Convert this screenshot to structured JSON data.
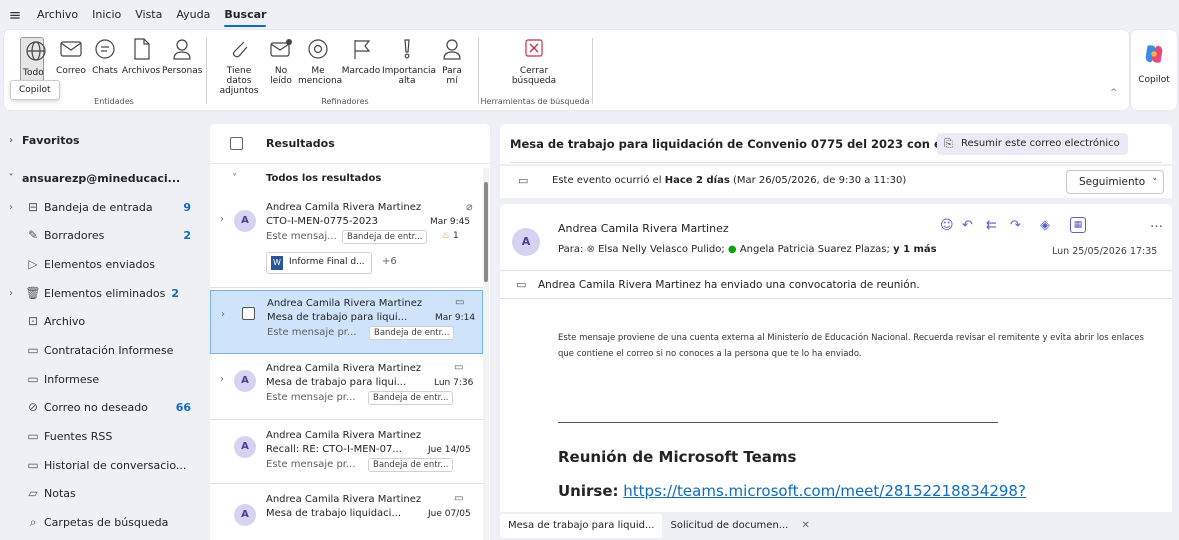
{
  "menubar": {
    "items": [
      "Archivo",
      "Inicio",
      "Vista",
      "Ayuda",
      "Buscar"
    ]
  },
  "ribbon": {
    "entidades": {
      "caption": "Entidades",
      "buttons": [
        "Todo",
        "Correo",
        "Chats",
        "Archivos",
        "Personas"
      ]
    },
    "refinadores": {
      "caption": "Refinadores",
      "buttons": [
        {
          "l1": "Tiene datos",
          "l2": "adjuntos"
        },
        {
          "l1": "No",
          "l2": "leído"
        },
        {
          "l1": "Me",
          "l2": "menciona"
        },
        {
          "l1": "Marcado",
          "l2": ""
        },
        {
          "l1": "Importancia",
          "l2": "alta"
        },
        {
          "l1": "Para",
          "l2": "mí"
        }
      ]
    },
    "herramientas": {
      "caption": "Herramientas de búsqueda",
      "close_l1": "Cerrar",
      "close_l2": "búsqueda"
    },
    "copilot_label": "Copilot",
    "tooltip": "Copilot"
  },
  "folders": {
    "favoritos": "Favoritos",
    "account": "ansuarezp@mineducaci...",
    "items": [
      {
        "label": "Bandeja de entrada",
        "count": "9"
      },
      {
        "label": "Borradores",
        "count": "2"
      },
      {
        "label": "Elementos enviados",
        "count": ""
      },
      {
        "label": "Elementos eliminados",
        "count": "2"
      },
      {
        "label": "Archivo",
        "count": ""
      },
      {
        "label": "Contratación Informese",
        "count": ""
      },
      {
        "label": "Informese",
        "count": ""
      },
      {
        "label": "Correo no deseado",
        "count": "66"
      },
      {
        "label": "Fuentes RSS",
        "count": ""
      },
      {
        "label": "Historial de conversacio...",
        "count": ""
      },
      {
        "label": "Notas",
        "count": ""
      },
      {
        "label": "Carpetas de búsqueda",
        "count": ""
      }
    ]
  },
  "results": {
    "title": "Resultados",
    "group": "Todos los resultados",
    "messages": [
      {
        "avatar": "A",
        "sender": "Andrea Camila Rivera Martinez",
        "subject": "CTO-I-MEN-0775-2023",
        "time": "Mar 9:45",
        "preview": "Este mensaj...",
        "tag": "Bandeja de entr...",
        "extra": "1",
        "attachment": "Informe Final d...",
        "more": "+6"
      },
      {
        "avatar": "",
        "sender": "Andrea Camila Rivera Martinez",
        "subject": "Mesa de trabajo para liqui...",
        "time": "Mar 9:14",
        "preview": "Este mensaje pr...",
        "tag": "Bandeja de entr..."
      },
      {
        "avatar": "A",
        "sender": "Andrea Camila Rivera Martinez",
        "subject": "Mesa de trabajo para liqui...",
        "time": "Lun 7:36",
        "preview": "Este mensaje pr...",
        "tag": "Bandeja de entr..."
      },
      {
        "avatar": "A",
        "sender": "Andrea Camila Rivera Martinez",
        "subject": "Recall: RE: CTO-I-MEN-07...",
        "time": "Jue 14/05",
        "preview": "Este mensaje pr...",
        "tag": "Bandeja de entr..."
      },
      {
        "avatar": "A",
        "sender": "Andrea Camila Rivera Martinez",
        "subject": "Mesa de trabajo liquidaci...",
        "time": "Jue 07/05",
        "preview": "",
        "tag": ""
      }
    ]
  },
  "reading": {
    "subject": "Mesa de trabajo para liquidación de Convenio 0775 del 2023 con el MEN",
    "summarize": "Resumir este correo electrónico",
    "event_prefix": "Este evento ocurrió el ",
    "event_bold": "Hace 2 días",
    "event_suffix": " (Mar 26/05/2026, de 9:30 a 11:30)",
    "followup": "Seguimiento",
    "sender": "Andrea Camila Rivera Martinez",
    "avatar": "A",
    "to_label": "Para:",
    "to1": "Elsa Nelly Velasco Pulido;",
    "to2": "Angela Patricia Suarez Plazas;",
    "to_more": "y 1 más",
    "date": "Lun 25/05/2026 17:35",
    "invite_note": "Andrea Camila Rivera Martinez ha enviado una convocatoria de reunión.",
    "external_warning": "Este mensaje proviene de una cuenta externa al Ministerio de Educación Nacional. Recuerda revisar el remitente y evita abrir los enlaces que contiene el correo si no conoces a la persona que te lo ha enviado.",
    "teams_title": "Reunión de Microsoft Teams",
    "join_label": "Unirse:",
    "join_link": "https://teams.microsoft.com/meet/28152218834298?"
  },
  "bottom_tabs": [
    "Mesa de trabajo para liquid...",
    "Solicitud de documen..."
  ]
}
